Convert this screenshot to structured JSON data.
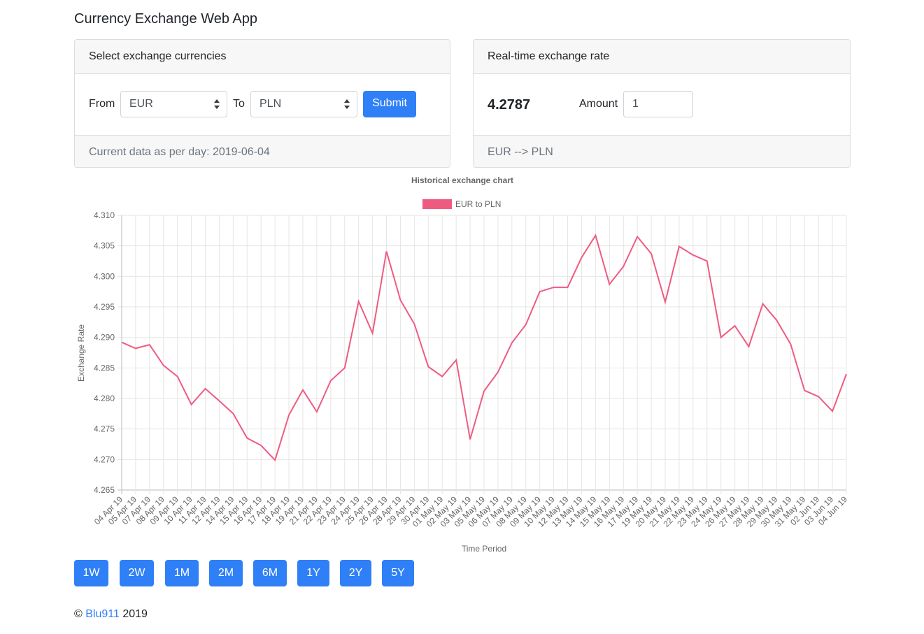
{
  "page_title": "Currency Exchange Web App",
  "select_card": {
    "header": "Select exchange currencies",
    "from_label": "From",
    "from_value": "EUR",
    "to_label": "To",
    "to_value": "PLN",
    "submit_label": "Submit",
    "footer": "Current data as per day: 2019-06-04"
  },
  "rate_card": {
    "header": "Real-time exchange rate",
    "rate": "4.2787",
    "amount_label": "Amount",
    "amount_value": "1",
    "footer": "EUR --> PLN"
  },
  "colors": {
    "accent": "#2f7ff7",
    "series": "#ef5b80"
  },
  "chart_data": {
    "type": "line",
    "title": "Historical exchange chart",
    "xlabel": "Time Period",
    "ylabel": "Exchange Rate",
    "legend_position": "top",
    "grid": true,
    "ylim": [
      4.265,
      4.31
    ],
    "yticks": [
      "4.265",
      "4.270",
      "4.275",
      "4.280",
      "4.285",
      "4.290",
      "4.295",
      "4.300",
      "4.305",
      "4.310"
    ],
    "categories": [
      "04 Apr 19",
      "05 Apr 19",
      "07 Apr 19",
      "08 Apr 19",
      "09 Apr 19",
      "10 Apr 19",
      "11 Apr 19",
      "12 Apr 19",
      "14 Apr 19",
      "15 Apr 19",
      "16 Apr 19",
      "17 Apr 19",
      "18 Apr 19",
      "19 Apr 19",
      "21 Apr 19",
      "22 Apr 19",
      "23 Apr 19",
      "24 Apr 19",
      "25 Apr 19",
      "26 Apr 19",
      "28 Apr 19",
      "29 Apr 19",
      "30 Apr 19",
      "01 May 19",
      "02 May 19",
      "03 May 19",
      "05 May 19",
      "06 May 19",
      "07 May 19",
      "08 May 19",
      "09 May 19",
      "10 May 19",
      "12 May 19",
      "13 May 19",
      "14 May 19",
      "15 May 19",
      "16 May 19",
      "17 May 19",
      "19 May 19",
      "20 May 19",
      "21 May 19",
      "22 May 19",
      "23 May 19",
      "24 May 19",
      "26 May 19",
      "27 May 19",
      "28 May 19",
      "29 May 19",
      "30 May 19",
      "31 May 19",
      "02 Jun 19",
      "03 Jun 19",
      "04 Jun 19"
    ],
    "series": [
      {
        "name": "EUR to PLN",
        "values": [
          4.2892,
          4.2882,
          4.2888,
          4.2854,
          4.2836,
          4.279,
          4.2816,
          4.2796,
          4.2775,
          4.2735,
          4.2723,
          4.2699,
          4.2773,
          4.2814,
          4.2778,
          4.2829,
          4.285,
          4.2959,
          4.2907,
          4.3041,
          4.2961,
          4.2922,
          4.2852,
          4.2836,
          4.2863,
          4.2733,
          4.2812,
          4.2843,
          4.2891,
          4.2921,
          4.2975,
          4.2982,
          4.2982,
          4.3031,
          4.3067,
          4.2987,
          4.3016,
          4.3065,
          4.3037,
          4.2958,
          4.3049,
          4.3035,
          4.3025,
          4.29,
          4.2919,
          4.2885,
          4.2955,
          4.2928,
          4.2889,
          4.2813,
          4.2803,
          4.2779,
          4.284
        ]
      }
    ]
  },
  "range_buttons": [
    "1W",
    "2W",
    "1M",
    "2M",
    "6M",
    "1Y",
    "2Y",
    "5Y"
  ],
  "footer": {
    "copyright": "©",
    "link": "Blu911",
    "year": "2019"
  }
}
